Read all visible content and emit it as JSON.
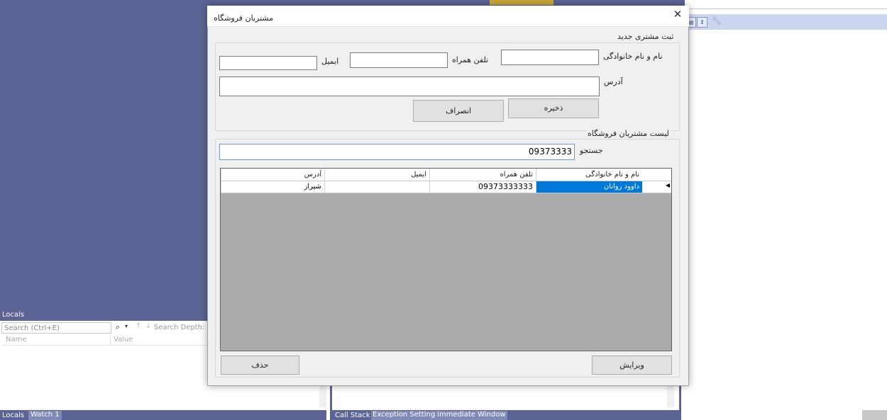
{
  "ide": {
    "locals_title": "Locals",
    "locals_search_placeholder": "Search (Ctrl+E)",
    "search_depth_label": "Search Depth:",
    "col_name": "Name",
    "col_value": "Value",
    "bottom_tabs_left": [
      "Locals",
      "Watch 1"
    ],
    "bottom_tabs_mid": [
      "Call Stack",
      "Exception Settings",
      "Immediate Window"
    ]
  },
  "dialog": {
    "title": "مشتریان فروشگاه",
    "close_glyph": "✕",
    "new_customer": {
      "legend": "ثبت مشتری جدید",
      "fullname_label": "نام و نام خانوادگی",
      "fullname_value": "",
      "mobile_label": "تلفن همراه",
      "mobile_value": "",
      "email_label": "ایمیل",
      "email_value": "",
      "address_label": "آدرس",
      "address_value": "",
      "save_label": "ذخیره",
      "cancel_label": "انصراف"
    },
    "customer_list": {
      "legend": "لیست مشتریان فروشگاه",
      "search_label": "جستجو",
      "search_value": "09373333",
      "columns": [
        "نام و نام خانوادگی",
        "تلفن همراه",
        "ایمیل",
        "آدرس"
      ],
      "rows": [
        {
          "fullname": "داوود روانان",
          "mobile": "09373333333",
          "email": "",
          "address": "شیراز"
        }
      ],
      "edit_label": "ویرایش",
      "delete_label": "حذف"
    }
  }
}
